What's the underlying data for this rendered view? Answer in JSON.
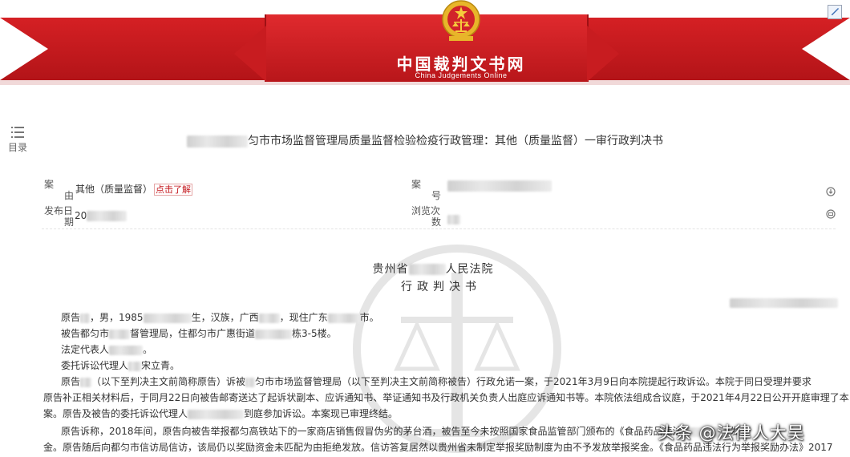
{
  "header": {
    "site_title": "中国裁判文书网",
    "site_subtitle": "China Judgements Online",
    "emblem_icon": "court-emblem-icon",
    "corner_icon": "page-edit-icon"
  },
  "toc": {
    "label": "目录",
    "icon": "list-icon"
  },
  "document": {
    "title_suffix": "匀市市场监督管理局质量监督检验检疫行政管理：其他（质量监督）一审行政判决书",
    "meta": {
      "cause_label": "案由",
      "cause_value": "其他（质量监督）",
      "cause_link": "点击了解",
      "number_label": "案号",
      "publish_label": "发布日期",
      "publish_value_prefix": "20",
      "views_label": "浏览次数"
    },
    "court_prefix": "贵州省",
    "court_suffix": "人民法院",
    "doc_kind": "行政判决书",
    "paragraphs": [
      {
        "parts": [
          "原告",
          "，男，1985",
          "生，汉族，广西",
          "，现住广东",
          "市。"
        ]
      },
      {
        "parts": [
          "被告都匀市",
          "督管理局，住都匀市广惠街道",
          "栋3-5楼。"
        ]
      },
      {
        "parts": [
          "法定代表人",
          "。"
        ]
      },
      {
        "parts": [
          "委托诉讼代理人",
          "宋立青。"
        ]
      },
      {
        "parts": [
          "原告",
          "（以下至判决主文前简称原告）诉被",
          "匀市市场监督管理局（以下至判决主文前简称被告）行政允诺一案，于2021年3月9日向本院提起行政诉讼。本院于同日受理并要求"
        ]
      },
      {
        "parts": [
          "原告补正相关材料后，于同月22日向被告邮寄送达了起诉状副本、应诉通知书、举证通知书及行政机关负责人出庭应诉通知书等。本院依法组成合议庭，于2021年4月22日公开开庭审理了本"
        ]
      },
      {
        "parts": [
          "案。原告及被告的委托诉讼代理人",
          "到庭参加诉讼。本案现已审理终结。"
        ]
      },
      {
        "parts": [
          "原告诉称，2018年间，原告向被告举报都匀高铁站下的一家商店销售假冒伪劣的茅台酒，被告至今未按照国家食品监管部门颁布的《食品药品违法",
          "发"
        ]
      },
      {
        "parts": [
          "金。原告随后向都匀市信访局信访，该局仍以奖励资金未匹配为由拒绝发放。信访答复居然以贵州省未制定举报奖励制度为由不予发放举报奖金。《食品药品违法行为举报奖励办法》2017"
        ]
      }
    ]
  },
  "watermark": "头条 @法律人大吴",
  "colors": {
    "brand_red": "#c81c20",
    "link_red": "#c4161c"
  }
}
